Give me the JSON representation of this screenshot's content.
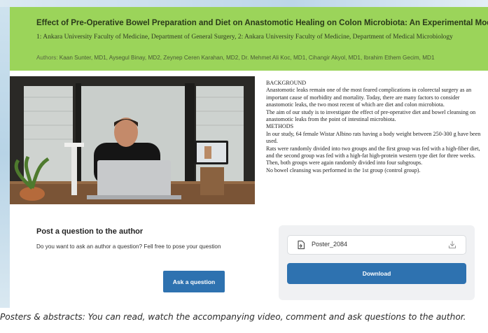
{
  "poster": {
    "title": "Effect of Pre-Operative Bowel Preparation and Diet on Anastomotic Healing on Colon Microbiota: An Experimental Model",
    "affiliations": "1: Ankara University Faculty of Medicine, Department of General Surgery, 2: Ankara University Faculty of Medicine, Department of Medical Microbiology",
    "authors_label": "Authors:",
    "authors": "Kaan Sunter, MD1, Aysegul Binay, MD2, Zeynep Ceren Karahan, MD2, Dr. Mehmet Ali Koc, MD1, Cihangir Akyol, MD1, Ibrahim Ethem Gecim, MD1"
  },
  "abstract": {
    "lines": [
      "BACKGROUND",
      "Anastomotic leaks remain one of the most feared complications in colorectal surgery as an important cause of morbidity and mortality. Today, there are many factors to consider anastomotic leaks, the two most recent of which are diet and colon microbiota.",
      "The aim of our study is to investigate the effect of pre-operative diet and bowel cleansing on anastomotic leaks from the point of intestinal microbiota.",
      "METHODS",
      "In our study, 64 female Wistar Albino rats having a body weight between 250-300 g have been used.",
      "Rats were randomly divided into two groups and the first group was fed with a high-fiber diet,",
      "and the second group was fed with a high-fat high-protein western type diet for three weeks.",
      "Then, both groups were again randomly divided into four subgroups.",
      "No bowel cleansing was performed in the 1st group (control group)."
    ]
  },
  "question": {
    "title": "Post a question to the author",
    "text": "Do you want to ask an author a question? Fell free to pose your question",
    "button": "Ask a question"
  },
  "download": {
    "file_name": "Poster_2084",
    "file_icon": "file-icon",
    "download_icon": "download-icon",
    "button": "Download"
  },
  "caption": "Posters & abstracts: You can read, watch the accompanying video, comment and ask questions to the author.",
  "colors": {
    "header_bg": "#9bd45a",
    "button_bg": "#2e72b0"
  }
}
